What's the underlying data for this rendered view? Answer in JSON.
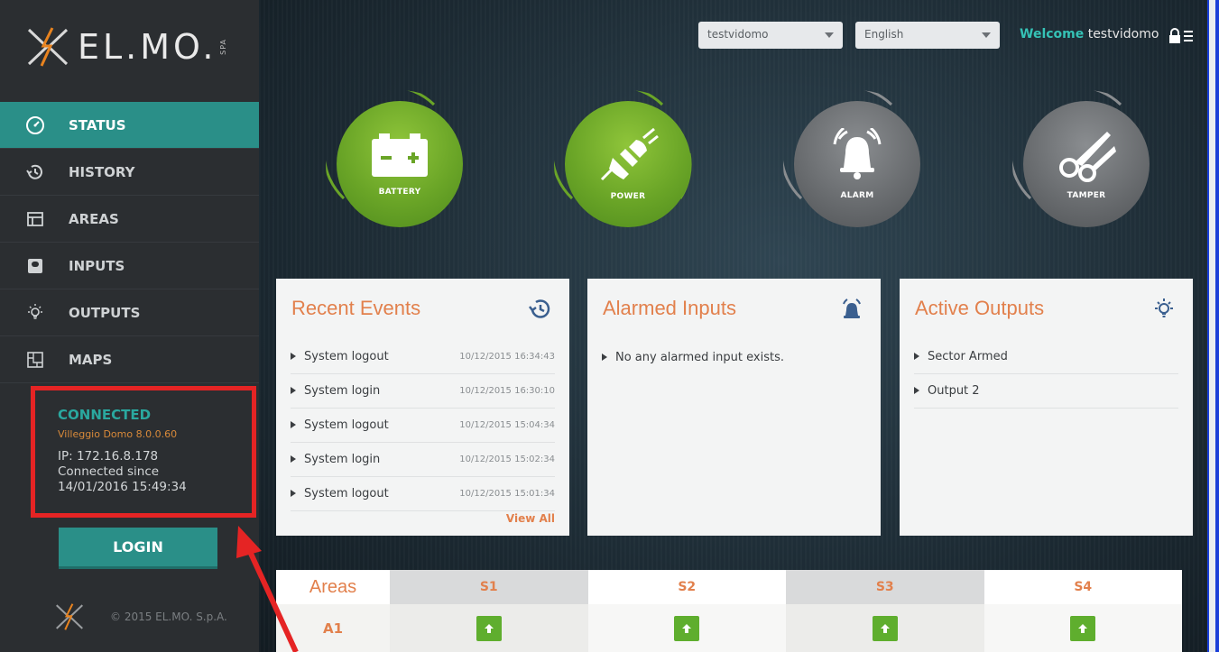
{
  "brand": {
    "name": "EL.MO.",
    "spa": "SPA"
  },
  "sidebar": {
    "items": [
      {
        "label": "STATUS",
        "icon": "speedometer-icon",
        "active": true
      },
      {
        "label": "HISTORY",
        "icon": "history-icon",
        "active": false
      },
      {
        "label": "AREAS",
        "icon": "areas-icon",
        "active": false
      },
      {
        "label": "INPUTS",
        "icon": "inputs-icon",
        "active": false
      },
      {
        "label": "OUTPUTS",
        "icon": "lightbulb-icon",
        "active": false
      },
      {
        "label": "MAPS",
        "icon": "map-icon",
        "active": false
      }
    ],
    "connection": {
      "status": "CONNECTED",
      "device": "Villeggio Domo 8.0.0.60",
      "ip": "IP: 172.16.8.178",
      "since_label": "Connected since",
      "since_value": "14/01/2016 15:49:34"
    },
    "login_label": "LOGIN",
    "copyright": "© 2015 EL.MO. S.p.A."
  },
  "topbar": {
    "user_select": "testvidomo",
    "language_select": "English",
    "welcome_label": "Welcome",
    "username": "testvidomo"
  },
  "status_indicators": [
    {
      "label": "BATTERY",
      "icon": "battery-icon",
      "state": "ok"
    },
    {
      "label": "POWER",
      "icon": "plug-icon",
      "state": "ok"
    },
    {
      "label": "ALARM",
      "icon": "bell-icon",
      "state": "idle"
    },
    {
      "label": "TAMPER",
      "icon": "scissors-icon",
      "state": "idle"
    }
  ],
  "panels": {
    "recent_events": {
      "title": "Recent Events",
      "events": [
        {
          "text": "System logout",
          "time": "10/12/2015 16:34:43"
        },
        {
          "text": "System login",
          "time": "10/12/2015 16:30:10"
        },
        {
          "text": "System logout",
          "time": "10/12/2015 15:04:34"
        },
        {
          "text": "System login",
          "time": "10/12/2015 15:02:34"
        },
        {
          "text": "System logout",
          "time": "10/12/2015 15:01:34"
        }
      ],
      "view_all": "View All"
    },
    "alarmed_inputs": {
      "title": "Alarmed Inputs",
      "items": [
        "No any alarmed input exists."
      ]
    },
    "active_outputs": {
      "title": "Active Outputs",
      "items": [
        "Sector Armed",
        "Output 2"
      ]
    }
  },
  "areas": {
    "title": "Areas",
    "columns": [
      "S1",
      "S2",
      "S3",
      "S4"
    ],
    "rows": [
      {
        "label": "A1",
        "cells": [
          "up-arrow-icon",
          "up-arrow-icon",
          "up-arrow-icon",
          "up-arrow-icon"
        ]
      }
    ]
  },
  "colors": {
    "accent_teal": "#2a8f88",
    "accent_orange": "#e2804c",
    "ok_green": "#6aa527",
    "annotation_red": "#e52424"
  }
}
